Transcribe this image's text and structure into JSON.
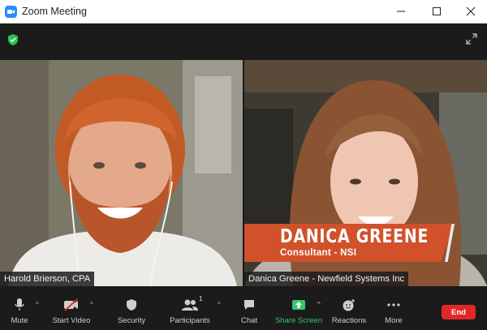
{
  "window": {
    "title": "Zoom Meeting",
    "controls": [
      "minimize",
      "maximize",
      "close"
    ]
  },
  "meeting": {
    "security_indicator_icon": "green-shield-check-icon",
    "fullscreen_icon": "expand-arrows-icon"
  },
  "participants": [
    {
      "name_tag": "Harold Brierson, CPA"
    },
    {
      "name_tag": "Danica Greene - Newfield Systems Inc"
    }
  ],
  "lower_third": {
    "name": "DANICA GREENE",
    "title": "Consultant - NSI",
    "color": "#d0512a"
  },
  "toolbar": {
    "mute_label": "Mute",
    "start_video_label": "Start Video",
    "security_label": "Security",
    "participants_label": "Participants",
    "participants_count": "1",
    "chat_label": "Chat",
    "share_screen_label": "Share Screen",
    "reactions_label": "Reactions",
    "more_label": "More",
    "end_label": "End"
  },
  "colors": {
    "accent": "#2d8cff",
    "share": "#37c66e",
    "end": "#e02828",
    "security_green": "#23c552"
  }
}
